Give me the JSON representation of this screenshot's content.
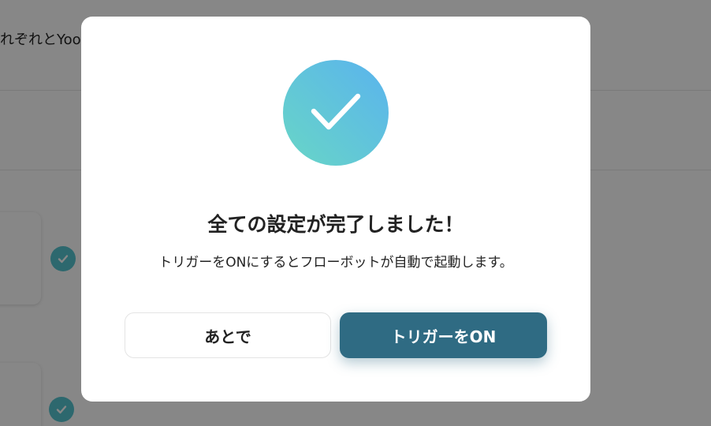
{
  "background": {
    "title_fragment": "れぞれとYoo"
  },
  "modal": {
    "title": "全ての設定が完了しました！",
    "message": "トリガーをONにするとフローボットが自動で起動します。",
    "later_button": "あとで",
    "trigger_on_button": "トリガーをON"
  },
  "colors": {
    "primary": "#2f6b83",
    "success_gradient_start": "#68d6c6",
    "success_gradient_end": "#5ab3ee",
    "overlay": "rgba(0,0,0,0.47)"
  },
  "icons": {
    "success": "check-icon",
    "step_status": "check-circle-icon"
  }
}
